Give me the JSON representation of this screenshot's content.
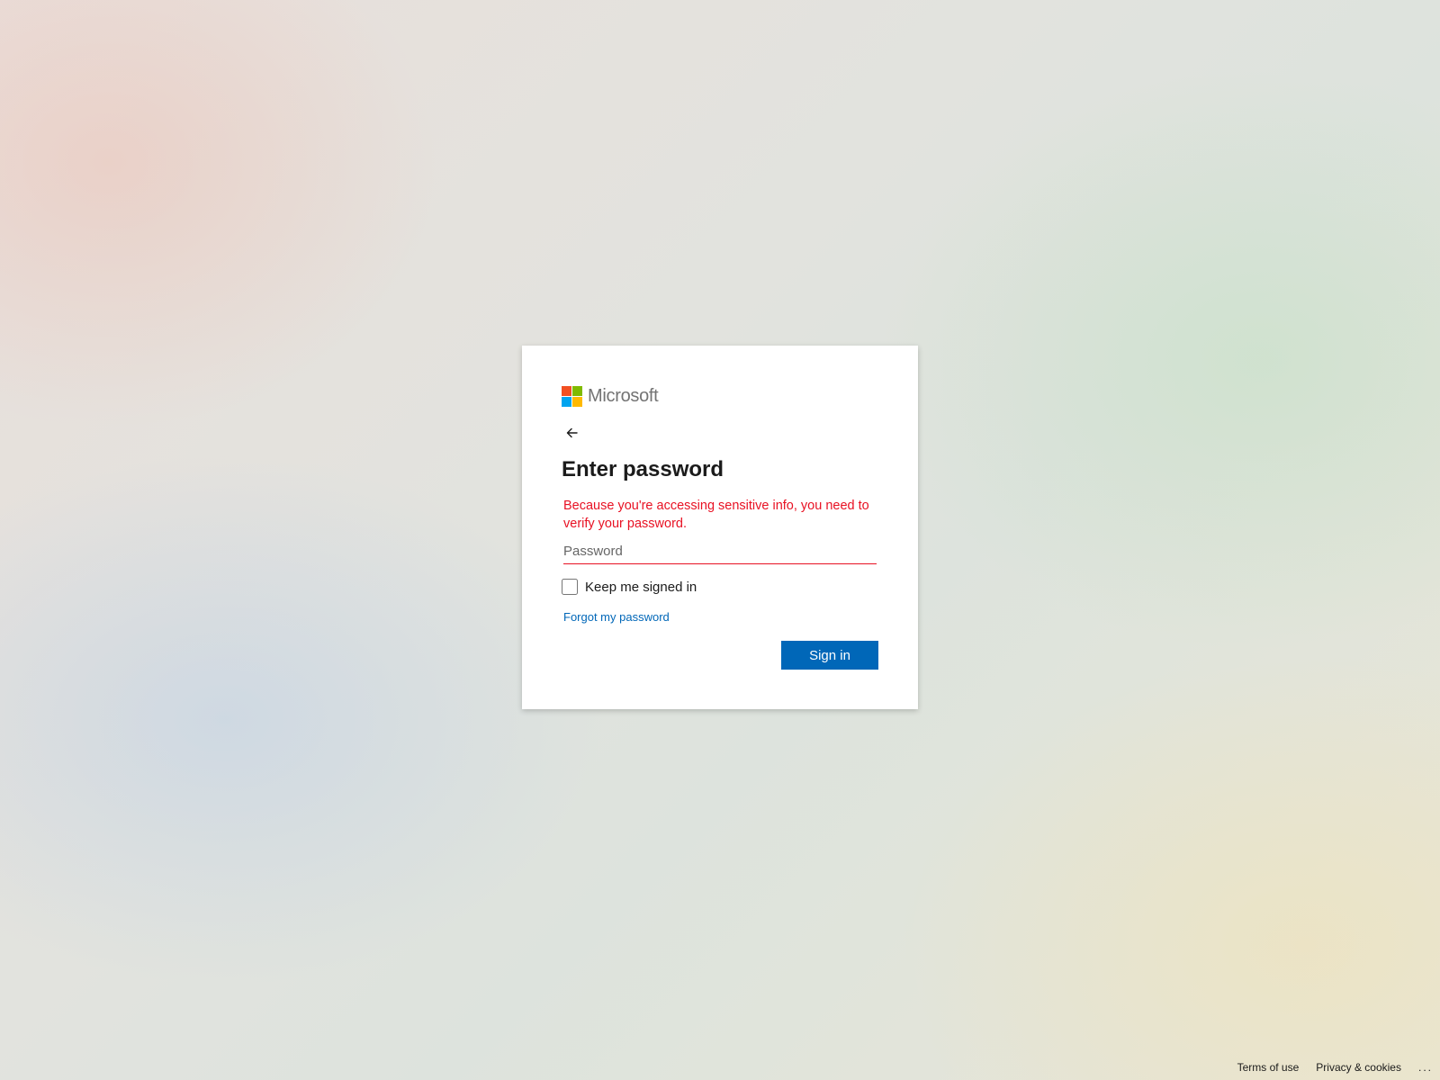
{
  "brand": {
    "name": "Microsoft",
    "logo_colors": [
      "#f25022",
      "#7fba00",
      "#00a4ef",
      "#ffb900"
    ]
  },
  "login": {
    "back_icon": "arrow-left-icon",
    "title": "Enter password",
    "error_message": "Because you're accessing sensitive info, you need to verify your password.",
    "password_placeholder": "Password",
    "password_value": "",
    "keep_signed_in_label": "Keep me signed in",
    "keep_signed_in_checked": false,
    "forgot_link": "Forgot my password",
    "submit_label": "Sign in"
  },
  "footer": {
    "terms": "Terms of use",
    "privacy": "Privacy & cookies",
    "more": "..."
  },
  "colors": {
    "accent": "#0067b8",
    "error": "#e81123",
    "text": "#1b1b1b"
  }
}
